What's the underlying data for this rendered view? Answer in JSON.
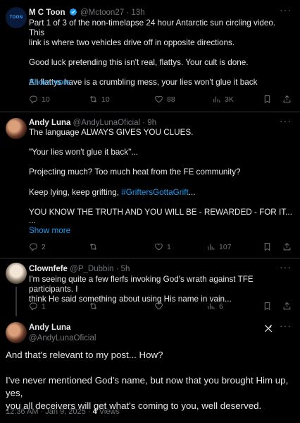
{
  "tweet1": {
    "name": "M C Toon",
    "handle": "@Mctoon27",
    "dot": "·",
    "time": "13h",
    "avatar_text": "TOON",
    "lines": [
      "Part 1 of 3 of the non-timelapse 24 hour Antarctic sun circling video.  This",
      "link is where two vehicles drive off in opposite directions.",
      "",
      "Good luck pretending this isn't real, flattys.  Your cult is done.",
      "",
      "All flattys have is a crumbling mess, your lies won't glue it back"
    ],
    "show_more": "Show more",
    "replies": "10",
    "reposts": "10",
    "likes": "88",
    "views": "3K"
  },
  "tweet2": {
    "name": "Andy Luna",
    "handle": "@AndyLunaOficial",
    "dot": "·",
    "time": "9h",
    "line1": "The language ALWAYS GIVES YOU CLUES.",
    "line2": "\"Your lies won't glue it back\"...",
    "line3": "Projecting much? Too much heat from the FE community?",
    "line4_pre": "Keep lying, keep grifting, ",
    "hashtag": "#GriftersGottaGrift",
    "line4_post": "...",
    "line5": "YOU KNOW THE TRUTH AND YOU WILL BE - REWARDED - FOR IT...",
    "line6": "...",
    "show_more": "Show more",
    "replies": "2",
    "reposts": "",
    "likes": "1",
    "views": "107"
  },
  "tweet3": {
    "name": "Clownfefe",
    "handle": "@P_Dubbin",
    "dot": "·",
    "time": "5h",
    "lines": [
      "I'm seeing quite a few flerfs invoking God's wrath against TFE participants. I",
      "think He said something about using His name in vain..."
    ],
    "replies": "1",
    "reposts": "",
    "likes": "",
    "views": "6"
  },
  "main": {
    "name": "Andy Luna",
    "handle": "@AndyLunaOficial",
    "lines": [
      "And that's relevant to my post... How?",
      "",
      "I've never mentioned God's name, but now that you brought Him up, yes,",
      "you all deceivers will get what's coming to you, well deserved."
    ],
    "time": "12:36 AM",
    "dot": "·",
    "date": "Jan 9, 2025",
    "dot2": "·",
    "views_count": "4",
    "views_label": "Views"
  },
  "colors": {
    "accent": "#1d9bf0",
    "muted": "#71767b",
    "text": "#e7e9ea",
    "background": "#000000"
  }
}
